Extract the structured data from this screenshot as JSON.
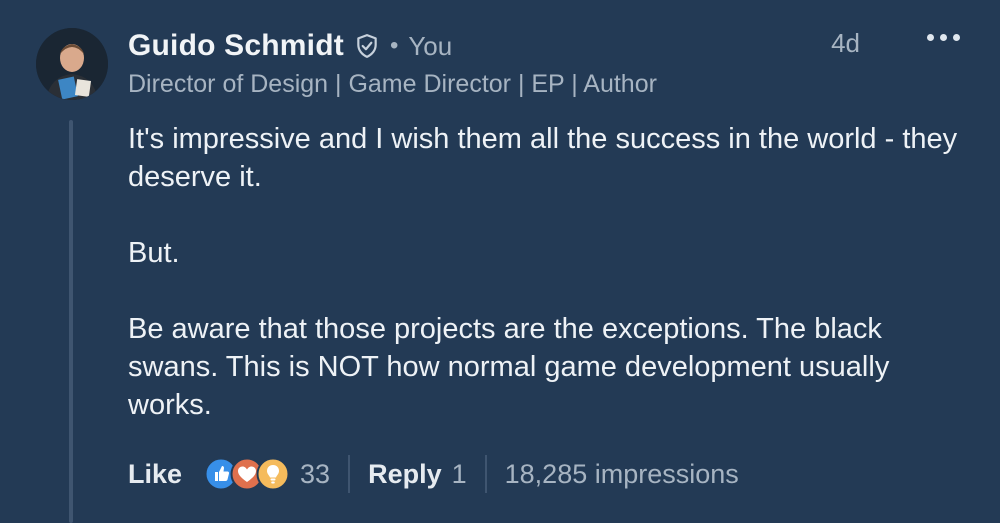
{
  "comment": {
    "author": "Guido Schmidt",
    "relation": "You",
    "separator_dot": "•",
    "timestamp": "4d",
    "headline": "Director of Design | Game Director | EP | Author",
    "paragraphs": [
      "It's impressive and I wish them all the success in the world - they deserve it.",
      "But.",
      "Be aware that those projects are the exceptions. The black swans. This is NOT how normal game development usually works."
    ]
  },
  "actions": {
    "like_label": "Like",
    "reaction_count": "33",
    "reply_label": "Reply",
    "reply_count": "1",
    "impressions": "18,285 impressions"
  },
  "colors": {
    "background": "#233a55",
    "text_primary": "#eef2f6",
    "text_secondary": "#a7b4c2",
    "like_blue": "#378fe9",
    "love_red": "#df704d",
    "insightful_yellow": "#f5bb5c"
  },
  "icons": {
    "verified": "shield-check-icon",
    "more": "more-horizontal-icon",
    "reactions": [
      "like-reaction-icon",
      "love-reaction-icon",
      "insightful-reaction-icon"
    ]
  }
}
